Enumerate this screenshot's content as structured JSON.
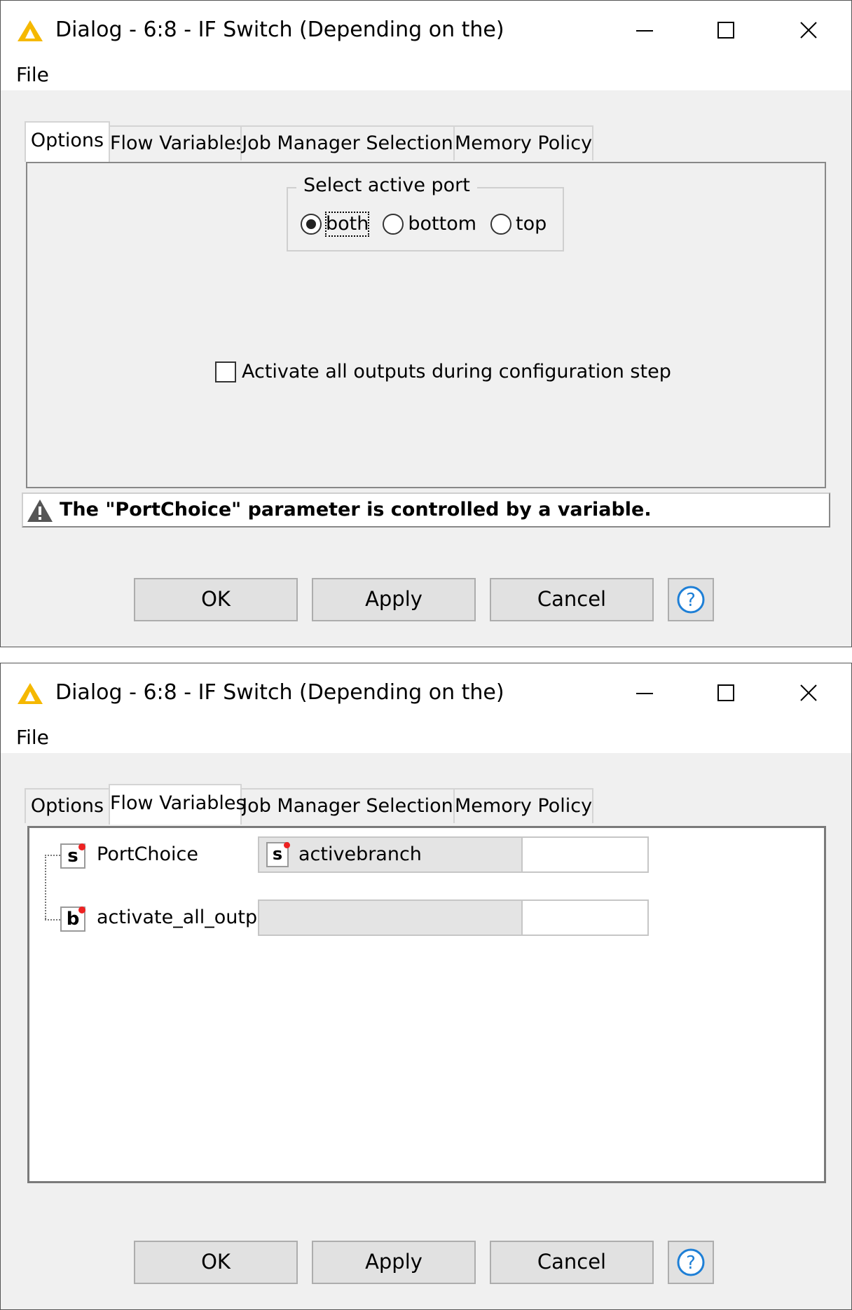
{
  "dialogs": [
    {
      "title": "Dialog - 6:8 - IF Switch (Depending on the)",
      "menu": [
        "File"
      ],
      "tabs": [
        "Options",
        "Flow Variables",
        "Job Manager Selection",
        "Memory Policy"
      ],
      "active_tab": "Options",
      "options": {
        "group_label": "Select active port",
        "radio_options": [
          "both",
          "bottom",
          "top"
        ],
        "selected_radio": "both",
        "checkbox_label": "Activate all outputs during configuration step",
        "checkbox_checked": false,
        "warning": "The \"PortChoice\" parameter is controlled by a variable."
      },
      "buttons": {
        "ok": "OK",
        "apply": "Apply",
        "cancel": "Cancel",
        "help": "?"
      }
    },
    {
      "title": "Dialog - 6:8 - IF Switch (Depending on the)",
      "menu": [
        "File"
      ],
      "tabs": [
        "Options",
        "Flow Variables",
        "Job Manager Selection",
        "Memory Policy"
      ],
      "active_tab": "Flow Variables",
      "flow_variables": [
        {
          "type": "s",
          "name": "PortChoice",
          "selected_variable": "activebranch",
          "variable_type": "s",
          "text_value": ""
        },
        {
          "type": "b",
          "name": "activate_all_outp...",
          "selected_variable": "",
          "variable_type": "",
          "text_value": ""
        }
      ],
      "buttons": {
        "ok": "OK",
        "apply": "Apply",
        "cancel": "Cancel",
        "help": "?"
      }
    }
  ],
  "colors": {
    "window_bg": "#f0f0f0",
    "accent_help": "#1e7fd6",
    "warning_icon": "#555555",
    "app_icon": "#f5b800",
    "variable_dot": "#e22222"
  },
  "icons": {
    "app": "knime-warning-triangle-icon",
    "minimize": "minimize-icon",
    "maximize": "maximize-icon",
    "close": "close-icon",
    "help": "help-question-icon",
    "warning": "warning-triangle-icon",
    "dropdown": "chevron-down-icon"
  }
}
